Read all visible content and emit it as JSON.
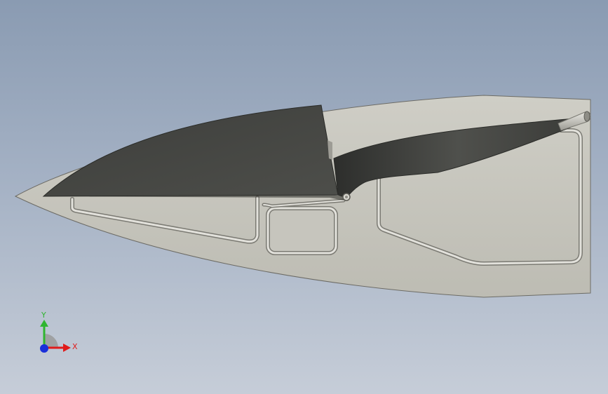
{
  "viewport": {
    "background_top": "#8a9bb2",
    "background_bottom": "#c6cdd8"
  },
  "model": {
    "hull_color": "#c2c1b8",
    "sail_color": "#464744",
    "tube_color": "#e0dfd9"
  },
  "triad": {
    "x_label": "X",
    "y_label": "Y",
    "x_color": "#e01b1b",
    "y_color": "#2fb52f",
    "z_color": "#1a2fd9"
  }
}
